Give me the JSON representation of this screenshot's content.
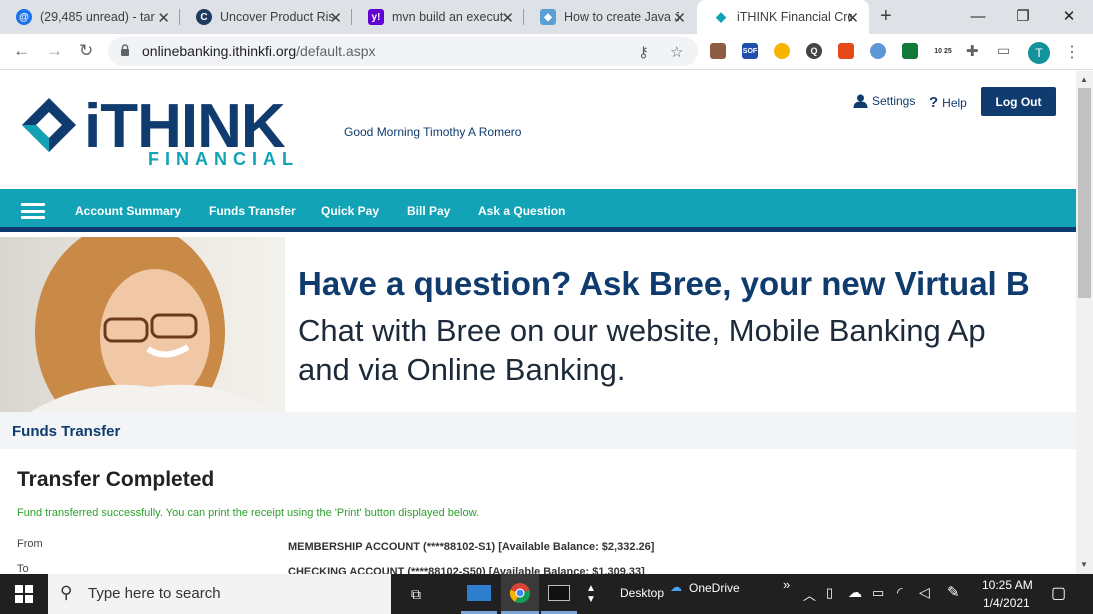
{
  "browser": {
    "tabs": [
      {
        "title": "(29,485 unread) - tar",
        "favicon": "mail-icon",
        "color": "#1a73e8"
      },
      {
        "title": "Uncover Product Ris",
        "favicon": "c-circle-icon",
        "color": "#1e3a5f"
      },
      {
        "title": "mvn build an execut",
        "favicon": "yahoo-icon",
        "color": "#6001d2"
      },
      {
        "title": "How to create Java J",
        "favicon": "puzzle-icon",
        "color": "#5aa0d8"
      },
      {
        "title": "iTHINK Financial Cre",
        "favicon": "ithink-icon",
        "color": "#12a3b6"
      }
    ],
    "url_host": "onlinebanking.ithinkfi.org",
    "url_path": "/default.aspx",
    "profile_initial": "T",
    "extensions": [
      {
        "name": "ext-photo-icon",
        "label": "",
        "color": "#8e5c42"
      },
      {
        "name": "ext-sof-icon",
        "label": "SOF",
        "color": "#1f4fa8"
      },
      {
        "name": "ext-swirl-icon",
        "label": "",
        "color": "#f4b400"
      },
      {
        "name": "ext-q-icon",
        "label": "Q",
        "color": "#444444"
      },
      {
        "name": "ext-megaphone-icon",
        "label": "",
        "color": "#e64a19"
      },
      {
        "name": "ext-sphere-icon",
        "label": "",
        "color": "#5e97d6"
      },
      {
        "name": "ext-green-icon",
        "label": "",
        "color": "#0f7a3a"
      },
      {
        "name": "ext-date-icon",
        "label": "10 25",
        "color": "#555555"
      }
    ]
  },
  "site": {
    "logo_word": "iTHINK",
    "logo_sub": "FINANCIAL",
    "greeting": "Good Morning Timothy A Romero",
    "settings_label": "Settings",
    "help_label": "Help",
    "logout_label": "Log Out",
    "nav": [
      "Account Summary",
      "Funds Transfer",
      "Quick Pay",
      "Bill Pay",
      "Ask a Question"
    ],
    "banner_title": "Have a question? Ask Bree, your new Virtual B",
    "banner_line1": "Chat with Bree on our website, Mobile Banking Ap",
    "banner_line2": "and via Online Banking.",
    "section_title": "Funds Transfer",
    "transfer_heading": "Transfer Completed",
    "transfer_message": "Fund transferred successfully. You can print the receipt using the 'Print' button displayed below.",
    "from_label": "From",
    "from_value": "MEMBERSHIP ACCOUNT (****88102-S1) [Available Balance: $2,332.26]",
    "to_label": "To",
    "to_value": "CHECKING ACCOUNT (****88102-S50) [Available Balance: $1,309.33]"
  },
  "taskbar": {
    "search_placeholder": "Type here to search",
    "desktop_label": "Desktop",
    "onedrive_label": "OneDrive",
    "time": "10:25 AM",
    "date": "1/4/2021",
    "chevron": "»"
  },
  "colors": {
    "brand_navy": "#0f3b6e",
    "brand_teal": "#12a3b6",
    "success_green": "#2ca02c"
  }
}
